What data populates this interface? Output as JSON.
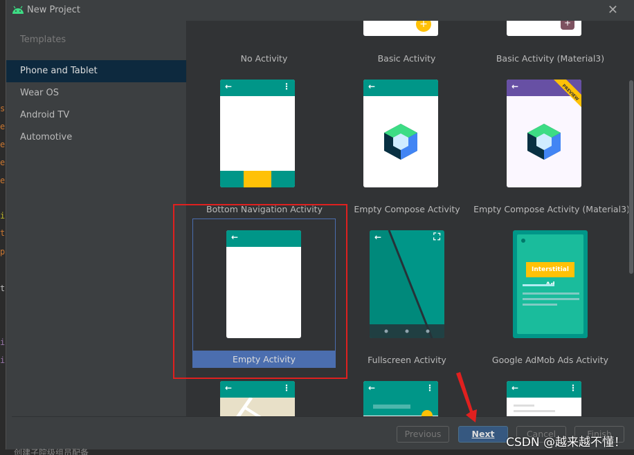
{
  "window": {
    "title": "New Project",
    "close_icon": "close-icon"
  },
  "sidebar": {
    "section_label": "Templates",
    "items": [
      {
        "label": "Phone and Tablet",
        "selected": true
      },
      {
        "label": "Wear OS",
        "selected": false
      },
      {
        "label": "Android TV",
        "selected": false
      },
      {
        "label": "Automotive",
        "selected": false
      }
    ]
  },
  "templates": [
    {
      "label": "No Activity"
    },
    {
      "label": "Basic Activity"
    },
    {
      "label": "Basic Activity (Material3)"
    },
    {
      "label": "Bottom Navigation Activity"
    },
    {
      "label": "Empty Compose Activity"
    },
    {
      "label": "Empty Compose Activity (Material3)",
      "badge": "PREVIEW"
    },
    {
      "label": "Empty Activity",
      "selected": true
    },
    {
      "label": "Fullscreen Activity"
    },
    {
      "label": "Google AdMob Ads Activity",
      "ad_text": "Interstitial Ad"
    }
  ],
  "footer": {
    "previous_label": "Previous",
    "next_label": "Next",
    "cancel_label": "Cancel",
    "finish_label": "Finish"
  },
  "overlay": {
    "watermark": "CSDN @越来越不懂！",
    "below_text": "创建子院级组员配备"
  },
  "colors": {
    "teal": "#009688",
    "amber": "#ffc107",
    "selection": "#4b6eaf",
    "highlight_red": "#e0201f",
    "primary_button": "#365880"
  }
}
